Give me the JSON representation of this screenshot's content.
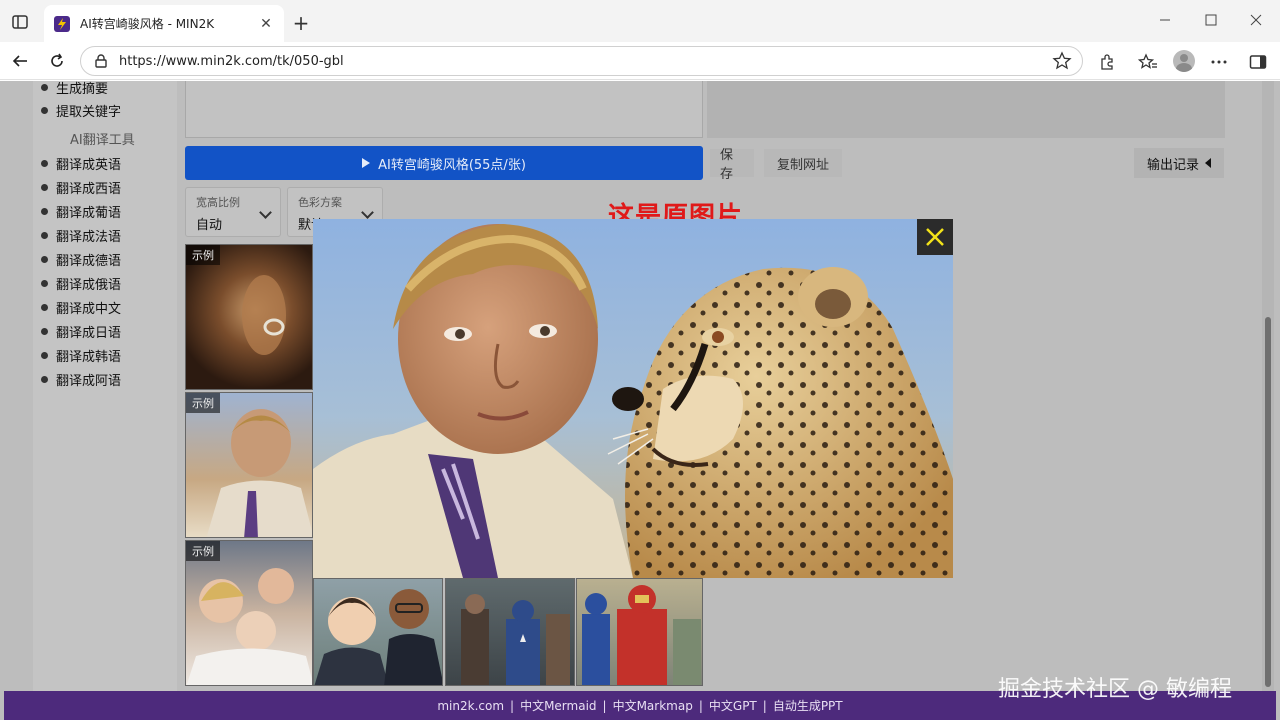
{
  "browser": {
    "tab_title": "AI转宫崎骏风格 - MIN2K",
    "url": "https://www.min2k.com/tk/050-gbl",
    "icons": [
      "tab-actions-icon",
      "favicon",
      "close-icon",
      "plus-icon",
      "minimize-icon",
      "maximize-icon",
      "close-window-icon",
      "back-icon",
      "reload-icon",
      "lock-icon",
      "star-icon",
      "extensions-icon",
      "favorites-icon",
      "avatar",
      "more-icon",
      "sidebar-icon"
    ]
  },
  "sidebar": {
    "top_items": [
      "生成摘要",
      "提取关键字"
    ],
    "section_title": "AI翻译工具",
    "translate_items": [
      "翻译成英语",
      "翻译成西语",
      "翻译成葡语",
      "翻译成法语",
      "翻译成德语",
      "翻译成俄语",
      "翻译成中文",
      "翻译成日语",
      "翻译成韩语",
      "翻译成阿语"
    ]
  },
  "toolbar": {
    "convert_label": "AI转宫崎骏风格(55点/张)",
    "save_label": "保存",
    "copy_url_label": "复制网址",
    "output_records_label": "输出记录"
  },
  "options": {
    "aspect": {
      "label": "宽高比例",
      "value": "自动"
    },
    "color": {
      "label": "色彩方案",
      "value": "默认"
    }
  },
  "examples": {
    "badge": "示例"
  },
  "modal": {
    "caption": "这是原图片"
  },
  "footer": {
    "links": [
      "min2k.com",
      "中文Mermaid",
      "中文Markmap",
      "中文GPT",
      "自动生成PPT"
    ],
    "separator": "|"
  },
  "watermark": "掘金技术社区 @ 敏编程",
  "colors": {
    "primary_button": "#1253c6",
    "footer_bg": "#4d2a7c",
    "caption_red": "#e01919",
    "close_x": "#f2e21a"
  }
}
